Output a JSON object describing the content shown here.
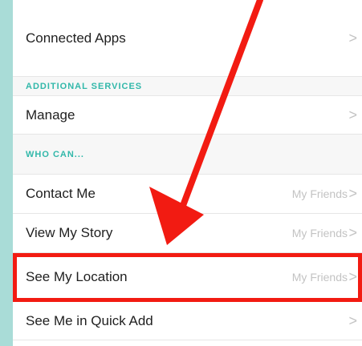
{
  "settings": {
    "connected_apps": "Connected Apps",
    "additional_services_header": "ADDITIONAL SERVICES",
    "manage": "Manage",
    "who_can_header": "WHO CAN...",
    "contact_me": {
      "label": "Contact Me",
      "value": "My Friends"
    },
    "view_my_story": {
      "label": "View My Story",
      "value": "My Friends"
    },
    "see_my_location": {
      "label": "See My Location",
      "value": "My Friends"
    },
    "see_me_quick_add": "See Me in Quick Add"
  },
  "annotation": {
    "color": "#f21b12"
  }
}
